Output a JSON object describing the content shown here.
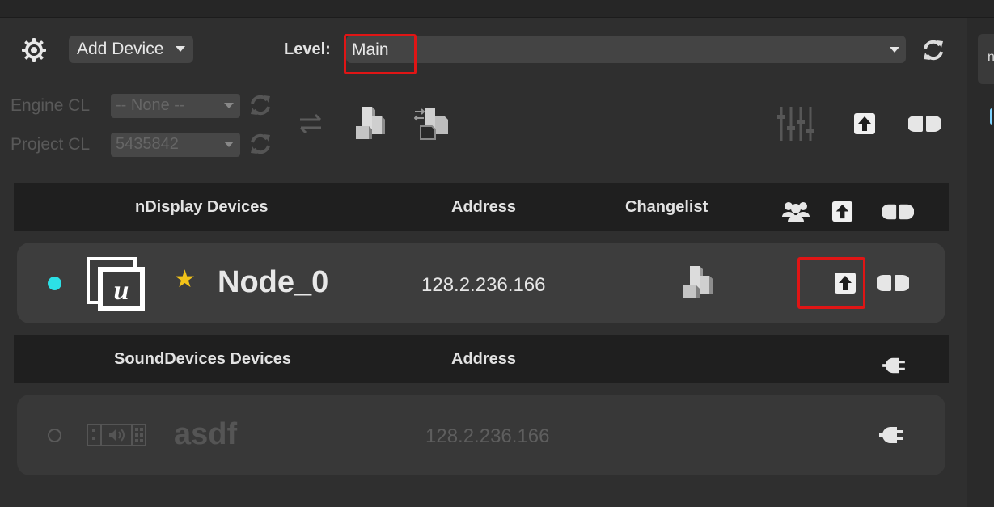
{
  "toolbar": {
    "add_device_label": "Add Device",
    "level_label": "Level:",
    "level_value": "Main",
    "engine_cl_label": "Engine CL",
    "engine_cl_value": "-- None --",
    "project_cl_label": "Project CL",
    "project_cl_value": "5435842"
  },
  "side_panel": {
    "tab_fragment": "n"
  },
  "ndisplay": {
    "header": {
      "devices": "nDisplay Devices",
      "address": "Address",
      "changelist": "Changelist"
    },
    "devices": [
      {
        "name": "Node_0",
        "address": "128.2.236.166",
        "status": "connected",
        "favorite": true
      }
    ]
  },
  "sound": {
    "header": {
      "devices": "SoundDevices Devices",
      "address": "Address"
    },
    "devices": [
      {
        "name": "asdf",
        "address": "128.2.236.166",
        "status": "disconnected"
      }
    ]
  },
  "colors": {
    "highlight_border": "#e01515",
    "status_active": "#2ce0e6",
    "favorite_star": "#f2c319"
  },
  "icons": [
    "gear-icon",
    "refresh-icon",
    "swap-icon",
    "blocks-icon",
    "sliders-icon",
    "upload-icon",
    "plug-icon",
    "users-icon",
    "unreal-logo-icon",
    "star-icon",
    "sound-device-icon"
  ]
}
